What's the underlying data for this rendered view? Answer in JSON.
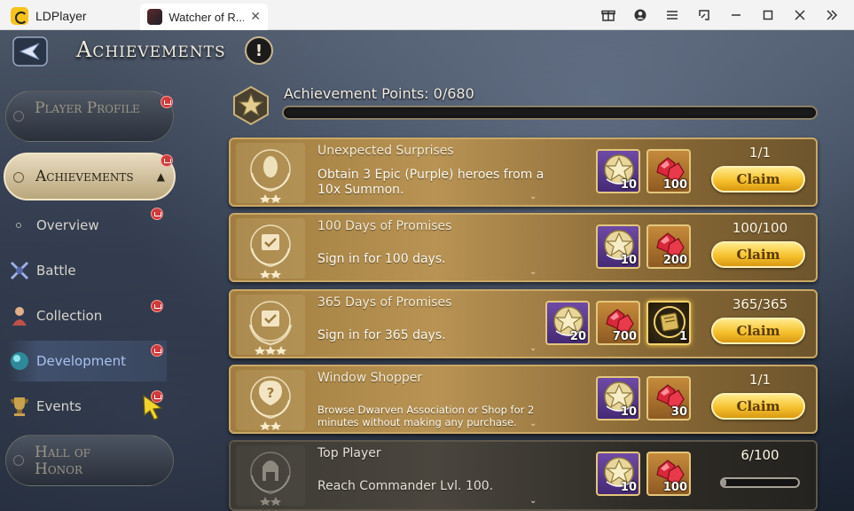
{
  "emulator": {
    "brand": "LDPlayer",
    "tab_title": "Watcher of R...",
    "tab_close": "✕",
    "controls": [
      "gift-icon",
      "account-icon",
      "menu-icon",
      "resize-icon",
      "minimize-icon",
      "maximize-icon",
      "close-icon",
      "expand-sidebar-icon"
    ]
  },
  "header": {
    "title": "Achievements",
    "alert": "!"
  },
  "sidebar": {
    "player_profile": "Player Profile",
    "achievements": "Achievements",
    "overview": "Overview",
    "battle": "Battle",
    "collection": "Collection",
    "development": "Development",
    "events": "Events",
    "hall_of_honor": "Hall of Honor",
    "selected": "Development"
  },
  "points": {
    "label": "Achievement Points:  0/680",
    "current": 0,
    "max": 680
  },
  "achievements": [
    {
      "title": "Unexpected Surprises",
      "desc": "Obtain 3 Epic (Purple) heroes from a 10x Summon.",
      "rewards": [
        {
          "icon": "star-token-icon",
          "qty": "10"
        },
        {
          "icon": "red-gem-icon",
          "qty": "100"
        }
      ],
      "progress": "1/1",
      "claim": "Claim"
    },
    {
      "title": "100 Days of Promises",
      "desc": "Sign in for 100 days.",
      "rewards": [
        {
          "icon": "star-token-icon",
          "qty": "10"
        },
        {
          "icon": "red-gem-icon",
          "qty": "200"
        }
      ],
      "progress": "100/100",
      "claim": "Claim"
    },
    {
      "title": "365 Days of Promises",
      "desc": "Sign in for 365 days.",
      "rewards": [
        {
          "icon": "star-token-icon",
          "qty": "20"
        },
        {
          "icon": "red-gem-icon",
          "qty": "700"
        },
        {
          "icon": "golden-book-icon",
          "qty": "1"
        }
      ],
      "progress": "365/365",
      "claim": "Claim"
    },
    {
      "title": "Window Shopper",
      "desc": "Browse Dwarven Association or Shop for 2 minutes without making any purchase.",
      "rewards": [
        {
          "icon": "star-token-icon",
          "qty": "10"
        },
        {
          "icon": "red-gem-icon",
          "qty": "30"
        }
      ],
      "progress": "1/1",
      "claim": "Claim"
    },
    {
      "title": "Top Player",
      "desc": "Reach Commander Lvl. 100.",
      "rewards": [
        {
          "icon": "star-token-icon",
          "qty": "10"
        },
        {
          "icon": "red-gem-icon",
          "qty": "100"
        }
      ],
      "progress": "6/100",
      "fraction": 0.06
    }
  ]
}
